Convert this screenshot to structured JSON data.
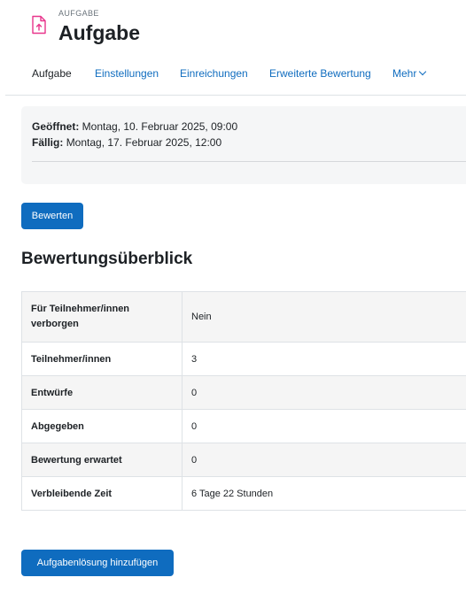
{
  "header": {
    "pretitle": "AUFGABE",
    "title": "Aufgabe",
    "icon": "assignment-icon",
    "icon_color": "#e8358c"
  },
  "tabs": [
    {
      "label": "Aufgabe",
      "active": true
    },
    {
      "label": "Einstellungen",
      "active": false
    },
    {
      "label": "Einreichungen",
      "active": false
    },
    {
      "label": "Erweiterte Bewertung",
      "active": false
    },
    {
      "label": "Mehr",
      "active": false,
      "icon": "chevron-down-icon"
    }
  ],
  "dates": {
    "opened_label": "Geöffnet:",
    "opened_value": "Montag, 10. Februar 2025, 09:00",
    "due_label": "Fällig:",
    "due_value": "Montag, 17. Februar 2025, 12:00"
  },
  "grade_button": "Bewerten",
  "summary": {
    "title": "Bewertungsüberblick",
    "rows": [
      {
        "label": "Für Teilnehmer/innen verborgen",
        "value": "Nein"
      },
      {
        "label": "Teilnehmer/innen",
        "value": "3"
      },
      {
        "label": "Entwürfe",
        "value": "0"
      },
      {
        "label": "Abgegeben",
        "value": "0"
      },
      {
        "label": "Bewertung erwartet",
        "value": "0"
      },
      {
        "label": "Verbleibende Zeit",
        "value": "6 Tage 22 Stunden"
      }
    ]
  },
  "add_submission_button": "Aufgabenlösung hinzufügen",
  "colors": {
    "primary": "#0f6cbf",
    "text": "#1d2125",
    "muted": "#6a737b"
  }
}
